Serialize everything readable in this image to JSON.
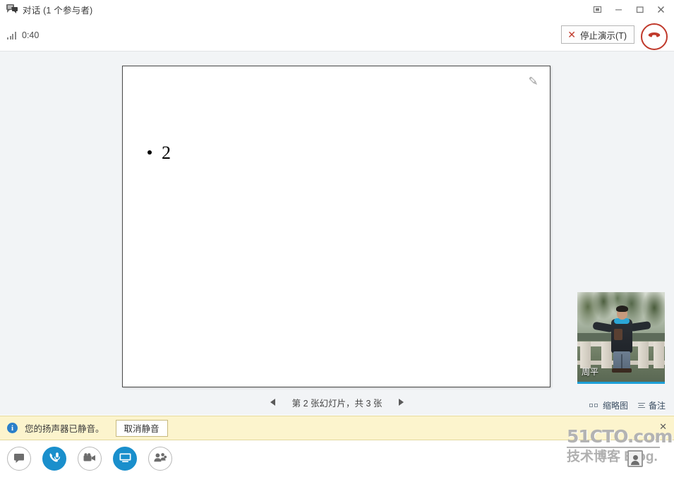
{
  "window": {
    "title": "对话 (1 个参与者)",
    "app_icon": "conversation-icon",
    "controls": {
      "popout_label": "弹出",
      "minimize_label": "最小化",
      "maximize_label": "最大化",
      "close_label": "关闭"
    }
  },
  "callbar": {
    "signal_icon": "signal-strength-icon",
    "timer": "0:40",
    "stop_present_label": "停止演示(T)",
    "stop_present_x": "✕",
    "hangup_icon": "hangup-phone-icon"
  },
  "stage": {
    "slide": {
      "bullet_text": "2",
      "pen_icon": "annotation-pen-icon"
    },
    "nav": {
      "prev_icon": "◀",
      "next_icon": "▶",
      "counter": "第 2 张幻灯片，共 3 张"
    },
    "links": [
      {
        "label": "缩略图",
        "icon": "thumbnails-icon"
      },
      {
        "label": "备注",
        "icon": "notes-icon"
      }
    ],
    "video": {
      "participant_name": "周平",
      "accent_color": "#1d9fd7"
    }
  },
  "notification": {
    "icon": "info-icon",
    "icon_glyph": "i",
    "message": "您的扬声器已静音。",
    "action_label": "取消静音"
  },
  "toolbar": {
    "buttons": [
      {
        "name": "chat",
        "icon": "chat-bubble-icon",
        "state": "inactive"
      },
      {
        "name": "call",
        "icon": "phone-mic-icon",
        "state": "active"
      },
      {
        "name": "video",
        "icon": "video-camera-icon",
        "state": "inactive"
      },
      {
        "name": "present",
        "icon": "monitor-present-icon",
        "state": "active"
      },
      {
        "name": "participants",
        "icon": "people-icon",
        "state": "inactive"
      }
    ]
  },
  "watermark": {
    "line1": "51CTO.com",
    "line2": "技术博客 Blog.",
    "close_glyph": "✕"
  },
  "colors": {
    "accent_blue": "#1a8fcc",
    "danger_red": "#c0392b",
    "notify_bg": "#fcf4cd",
    "stage_bg": "#f2f4f6"
  }
}
